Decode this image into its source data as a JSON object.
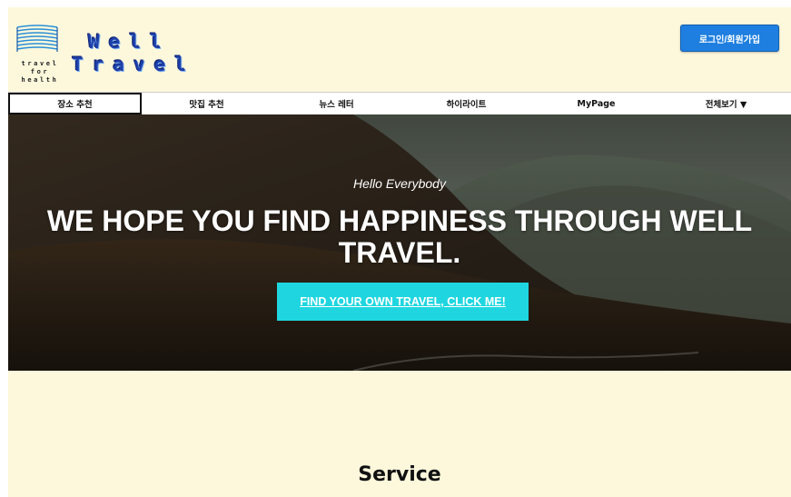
{
  "brand": {
    "word1": "Well",
    "word2": "Travel",
    "tagline": [
      "travel",
      "for",
      "health"
    ],
    "color": "#1f3fa8"
  },
  "header": {
    "login_label": "로그인/회원가입",
    "login_color": "#1f7fe0"
  },
  "nav": {
    "items": [
      {
        "label": "장소 추천",
        "active": true
      },
      {
        "label": "맛집 추천"
      },
      {
        "label": "뉴스 레터"
      },
      {
        "label": "하이라이트"
      },
      {
        "label": "MyPage"
      },
      {
        "label": "전체보기 ▼"
      }
    ]
  },
  "hero": {
    "subtitle": "Hello Everybody",
    "title": "WE HOPE YOU FIND HAPPINESS THROUGH WELL TRAVEL.",
    "cta_label": "FIND YOUR OWN TRAVEL, CLICK ME!",
    "cta_color": "#1fd6e0"
  },
  "section": {
    "title": "Service"
  },
  "background_color": "#fdf8dc"
}
